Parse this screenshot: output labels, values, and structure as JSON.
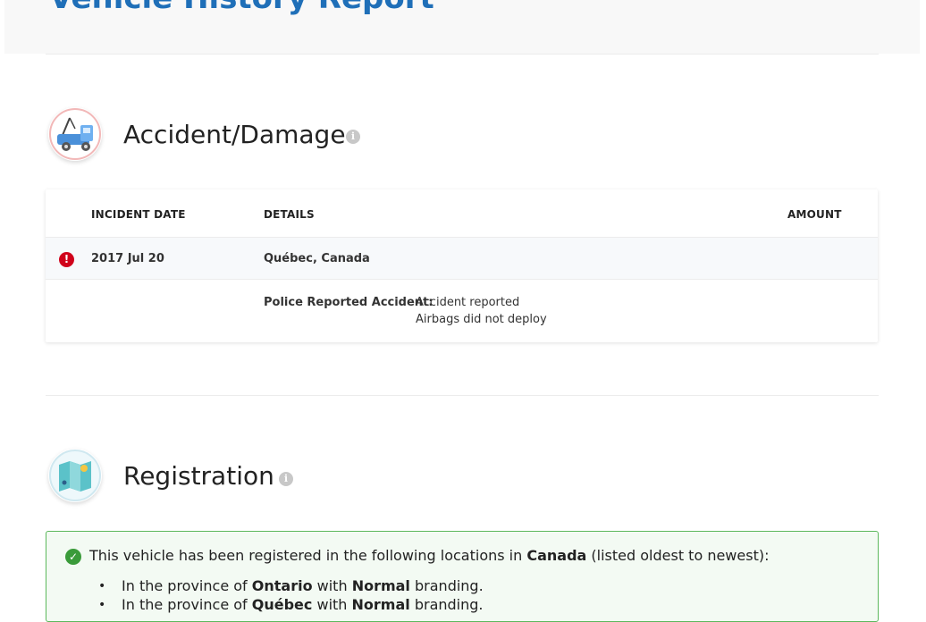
{
  "header": {
    "report_title": "Vehicle History Report"
  },
  "accident": {
    "title": "Accident/Damage",
    "info_glyph": "i",
    "table": {
      "headers": {
        "date": "INCIDENT DATE",
        "details": "DETAILS",
        "amount": "AMOUNT"
      },
      "rows": [
        {
          "status_glyph": "!",
          "date": "2017 Jul 20",
          "location": "Québec, Canada",
          "detail_label": "Police Reported Accident:",
          "detail_lines": [
            "Accident reported",
            "Airbags did not deploy"
          ],
          "amount": ""
        }
      ]
    }
  },
  "registration": {
    "title": "Registration",
    "info_glyph": "i",
    "summary": {
      "check_glyph": "✓",
      "prefix": "This vehicle has been registered in the following locations in ",
      "country": "Canada",
      "suffix": " (listed oldest to newest):"
    },
    "locations": [
      {
        "bullet": "•",
        "prefix": "In the province of ",
        "province": "Ontario",
        "mid": " with ",
        "branding": "Normal",
        "suffix": " branding."
      },
      {
        "bullet": "•",
        "prefix": "In the province of ",
        "province": "Québec",
        "mid": " with ",
        "branding": "Normal",
        "suffix": " branding."
      }
    ]
  },
  "colors": {
    "title_blue": "#1f6fb8",
    "alert_red": "#d0021b",
    "success_green": "#3a9b3a",
    "success_border": "#5cb85c"
  }
}
